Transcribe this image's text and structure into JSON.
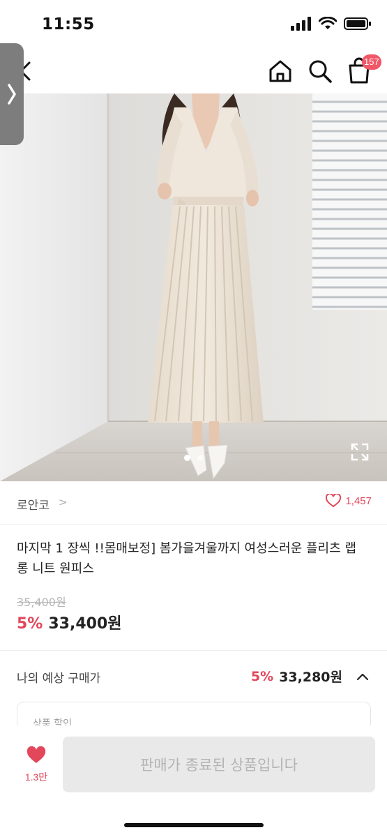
{
  "status_bar": {
    "time": "11:55"
  },
  "header": {
    "cart_count": "157"
  },
  "image": {
    "slide_count": 2,
    "active_slide": 1
  },
  "shop": {
    "name": "로안코",
    "chevron": ">",
    "like_count": "1,457"
  },
  "product": {
    "title": "마지막 1 장씩 !!몸매보정] 봄가을겨울까지 여성스러운 플리츠 랩 롱 니트 원피스",
    "original_price": "35,400원",
    "discount_rate": "5%",
    "sale_price": "33,400원"
  },
  "expected": {
    "label": "나의 예상 구매가",
    "rate": "5%",
    "price": "33,280원",
    "box_label": "상품 할인"
  },
  "bottom": {
    "wish_count": "1.3만",
    "soldout_label": "판매가 종료된 상품입니다"
  },
  "colors": {
    "accent": "#e2475a",
    "badge": "#f25767",
    "disabled_bg": "#e9e9e9"
  }
}
